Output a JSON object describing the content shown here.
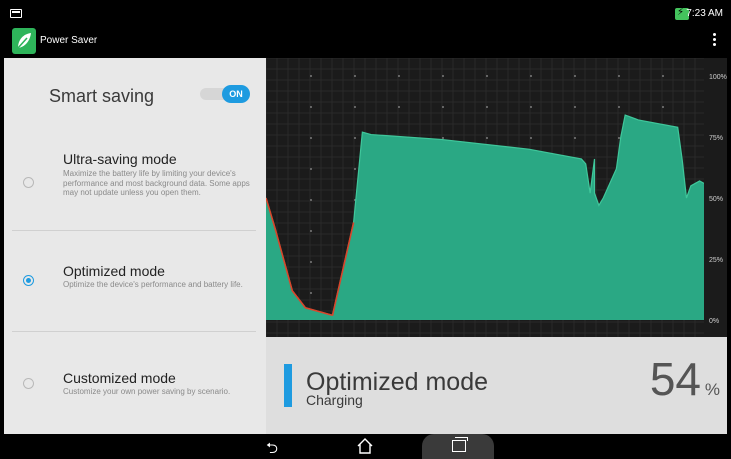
{
  "status_bar": {
    "time": "7:23 AM",
    "icons": [
      "notification-icon",
      "battery-charging-icon"
    ]
  },
  "app_bar": {
    "title": "Power Saver",
    "app_icon": "leaf-icon",
    "menu_icon": "overflow-menu-icon"
  },
  "smart_saving": {
    "label": "Smart saving",
    "toggle_state": "ON"
  },
  "modes": [
    {
      "title": "Ultra-saving mode",
      "description": "Maximize the battery life by limiting your device's performance and most background data. Some apps may not update unless you open them.",
      "selected": false
    },
    {
      "title": "Optimized mode",
      "description": "Optimize the device's performance and battery life.",
      "selected": true
    },
    {
      "title": "Customized mode",
      "description": "Customize your own power saving by scenario.",
      "selected": false
    }
  ],
  "battery_info": {
    "mode": "Optimized mode",
    "status": "Charging",
    "percent": "54",
    "percent_sign": "%"
  },
  "colors": {
    "accent": "#1e9be0",
    "graph_fill": "#2aa884",
    "graph_bg": "#1b1b1b",
    "low_battery_line": "#d9452b"
  },
  "navigation": {
    "back_icon": "back-icon",
    "home_icon": "home-icon",
    "recent_icon": "recent-apps-icon"
  },
  "chart_data": {
    "type": "area",
    "title": "",
    "xlabel": "",
    "ylabel": "",
    "ylim": [
      0,
      100
    ],
    "y_ticks": [
      "100%",
      "75%",
      "50%",
      "25%",
      "0%"
    ],
    "series": [
      {
        "values": [
          {
            "x": 0,
            "y": 50
          },
          {
            "x": 2,
            "y": 38
          },
          {
            "x": 6,
            "y": 12
          },
          {
            "x": 9,
            "y": 5
          },
          {
            "x": 15,
            "y": 2
          },
          {
            "x": 15.2,
            "y": 2
          },
          {
            "x": 20,
            "y": 40
          },
          {
            "x": 22,
            "y": 77
          },
          {
            "x": 24,
            "y": 76
          },
          {
            "x": 40,
            "y": 74
          },
          {
            "x": 60,
            "y": 70
          },
          {
            "x": 75,
            "y": 66
          },
          {
            "x": 72,
            "y": 66
          },
          {
            "x": 73,
            "y": 64
          },
          {
            "x": 74,
            "y": 52
          },
          {
            "x": 75,
            "y": 52
          },
          {
            "x": 76,
            "y": 47
          },
          {
            "x": 77,
            "y": 50
          },
          {
            "x": 80,
            "y": 62
          },
          {
            "x": 81,
            "y": 75
          },
          {
            "x": 82,
            "y": 84
          },
          {
            "x": 85,
            "y": 82
          },
          {
            "x": 94,
            "y": 79
          },
          {
            "x": 95,
            "y": 66
          },
          {
            "x": 96,
            "y": 50
          },
          {
            "x": 97,
            "y": 55
          },
          {
            "x": 99,
            "y": 57
          },
          {
            "x": 100,
            "y": 56
          }
        ]
      }
    ]
  }
}
